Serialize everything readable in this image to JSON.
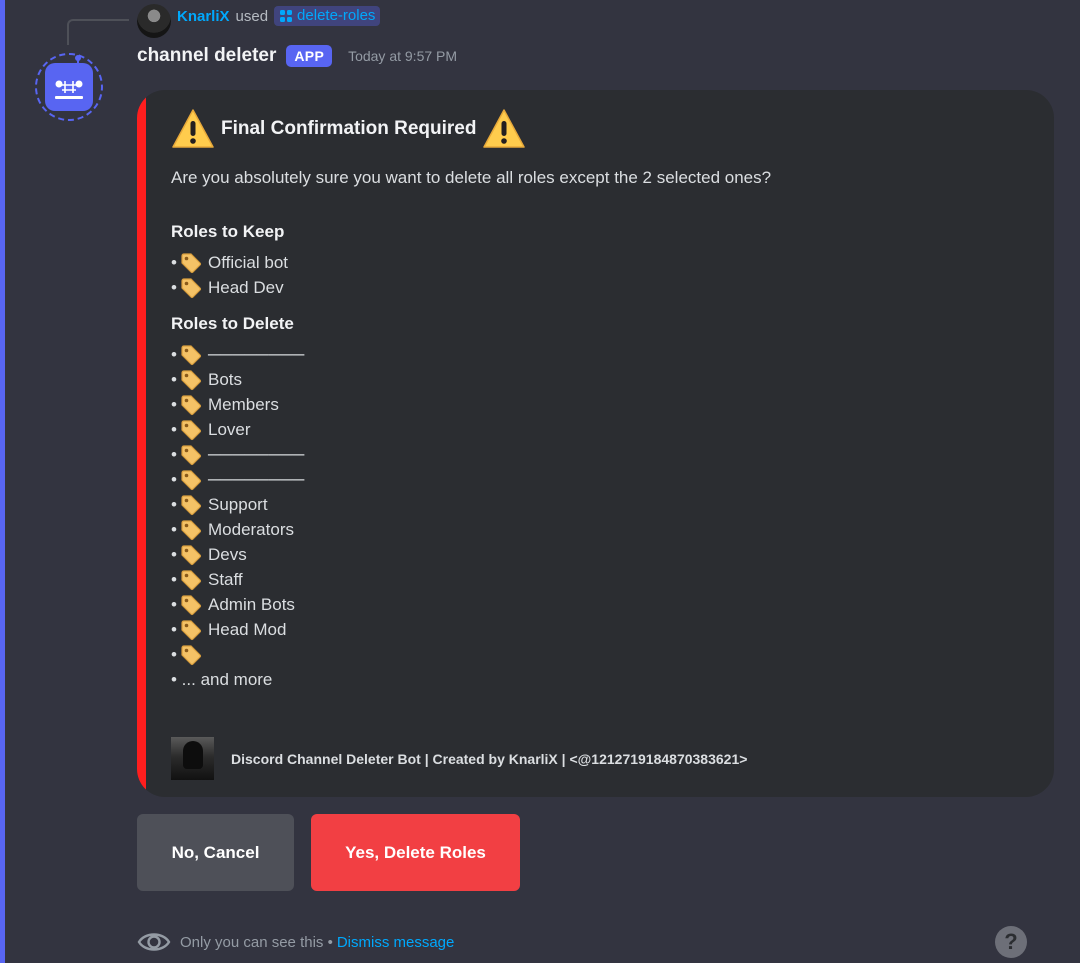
{
  "reply": {
    "username": "KnarliX",
    "used_text": "used",
    "command": "delete-roles"
  },
  "message": {
    "bot_name": "channel deleter",
    "badge": "APP",
    "timestamp": "Today at 9:57 PM"
  },
  "embed": {
    "accent_color": "#ff1e1e",
    "title": "Final Confirmation Required",
    "title_icon": "warning-icon",
    "description": "Are you absolutely sure you want to delete all roles except the 2 selected ones?",
    "keep_title": "Roles to Keep",
    "keep_roles": [
      "Official bot",
      "Head Dev"
    ],
    "delete_title": "Roles to Delete",
    "delete_roles": [
      "────────",
      "Bots",
      "Members",
      "Lover",
      "────────",
      "────────",
      "Support",
      "Moderators",
      "Devs",
      "Staff",
      "Admin Bots",
      "Head Mod",
      ""
    ],
    "more_text": "• ... and more",
    "role_icon": "label-tag-icon",
    "footer_text": "Discord Channel Deleter Bot | Created by KnarliX | <@1212719184870383621>"
  },
  "buttons": {
    "cancel": "No, Cancel",
    "confirm": "Yes, Delete Roles"
  },
  "ephemeral": {
    "text": "Only you can see this •",
    "dismiss": "Dismiss message"
  },
  "colors": {
    "background": "#333440",
    "embed_bg": "#2b2d31",
    "blurple": "#5865f2",
    "danger": "#f23f43",
    "link": "#00a8fc"
  }
}
